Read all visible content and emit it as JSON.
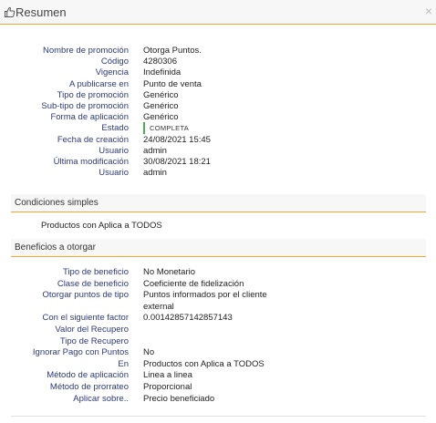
{
  "dialog": {
    "title": "Resumen",
    "close_glyph": "×",
    "title_icon": "thumbs-up-icon"
  },
  "summary": {
    "rows": [
      {
        "label": "Nombre de promoción",
        "value": "Otorga Puntos."
      },
      {
        "label": "Código",
        "value": "4280306"
      },
      {
        "label": "Vigencia",
        "value": "Indefinida"
      },
      {
        "label": "A publicarse en",
        "value": "Punto de venta"
      },
      {
        "label": "Tipo de promoción",
        "value": "Genérico"
      },
      {
        "label": "Sub-tipo de promoción",
        "value": "Genérico"
      },
      {
        "label": "Forma de aplicación",
        "value": "Genérico"
      },
      {
        "label": "Estado",
        "value": "COMPLETA"
      },
      {
        "label": "Fecha de creación",
        "value": "24/08/2021 15:45"
      },
      {
        "label": "Usuario",
        "value": "admin"
      },
      {
        "label": "Última modificación",
        "value": "30/08/2021 18:21"
      },
      {
        "label": "Usuario",
        "value": "admin"
      }
    ],
    "status_color": "#4caf50"
  },
  "conditions": {
    "title": "Condiciones simples",
    "text": "Productos con Aplica a TODOS"
  },
  "benefits": {
    "title": "Beneficios a otorgar",
    "rows": [
      {
        "label": "Tipo de beneficio",
        "value": "No Monetario"
      },
      {
        "label": "Clase de beneficio",
        "value": "Coeficiente de fidelización"
      },
      {
        "label": "Otorgar puntos de tipo",
        "value": "Puntos informados por el cliente"
      },
      {
        "label": "",
        "value": "external"
      },
      {
        "label": "Con el siguiente factor",
        "value": "0.00142857142857143"
      },
      {
        "label": "Valor del Recupero",
        "value": ""
      },
      {
        "label": "Tipo de Recupero",
        "value": ""
      },
      {
        "label": "Ignorar Pago con Puntos",
        "value": "No"
      },
      {
        "label": "En",
        "value": "Productos con Aplica a TODOS"
      },
      {
        "label": "Método de aplicación",
        "value": "Linea a linea"
      },
      {
        "label": "Método de prorrateo",
        "value": "Proporcional"
      },
      {
        "label": "Aplicar sobre..",
        "value": "Precio beneficiado"
      }
    ]
  },
  "colors": {
    "accent": "#f0a830",
    "label": "#2c3a7a"
  }
}
